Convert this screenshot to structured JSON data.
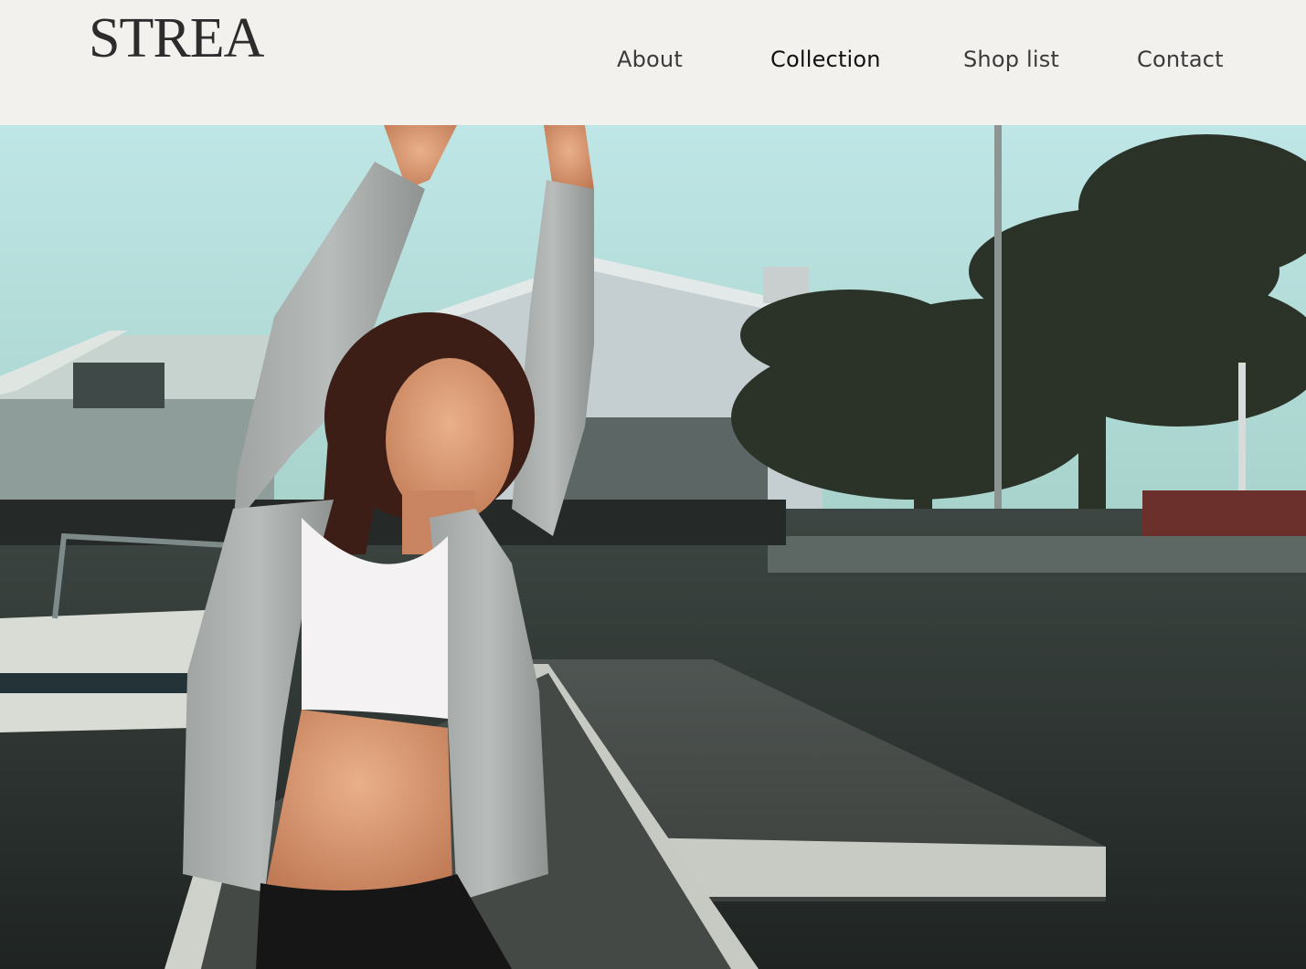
{
  "brand": {
    "logo_text": "STREA"
  },
  "nav": {
    "items": [
      {
        "label": "About",
        "active": false
      },
      {
        "label": "Collection",
        "active": true
      },
      {
        "label": "Shop list",
        "active": false
      },
      {
        "label": "Contact",
        "active": false
      }
    ]
  },
  "colors": {
    "header_bg": "#f2f1ed",
    "text": "#2c2c2c",
    "sky": "#bfe3e3"
  }
}
